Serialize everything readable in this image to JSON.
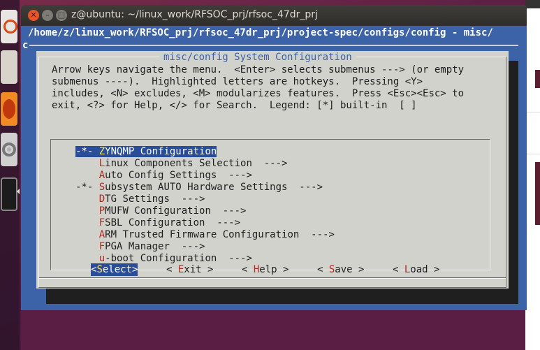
{
  "window": {
    "title": "z@ubuntu: ~/linux_work/RFSOC_prj/rfsoc_47dr_prj",
    "path_line": "/home/z/linux_work/RFSOC_prj/rfsoc_47dr_prj/project-spec/configs/config - misc/",
    "path_line_cont": "c",
    "close_label": "✕",
    "min_label": "–",
    "max_label": "□"
  },
  "dialog": {
    "title": "misc/config System Configuration",
    "help_text": "Arrow keys navigate the menu.  <Enter> selects submenus ---> (or empty\nsubmenus ----).  Highlighted letters are hotkeys.  Pressing <Y>\nincludes, <N> excludes, <M> modularizes features.  Press <Esc><Esc> to\nexit, <?> for Help, </> for Search.  Legend: [*] built-in  [ ]",
    "more_indicator": "↓(+)"
  },
  "menu": {
    "items": [
      {
        "prefix": "-*- ",
        "hotkey": "Z",
        "rest": "YNQMP Configuration",
        "suffix": "",
        "selected": true
      },
      {
        "prefix": "    ",
        "hotkey": "L",
        "rest": "inux Components Selection",
        "suffix": "  --->"
      },
      {
        "prefix": "    ",
        "hotkey": "A",
        "rest": "uto Config Settings",
        "suffix": "  --->"
      },
      {
        "prefix": "-*- ",
        "hotkey": "S",
        "rest": "ubsystem AUTO Hardware Settings",
        "suffix": "  --->"
      },
      {
        "prefix": "    ",
        "hotkey": "D",
        "rest": "TG Settings",
        "suffix": "  --->"
      },
      {
        "prefix": "    ",
        "hotkey": "P",
        "rest": "MUFW Configuration",
        "suffix": "  --->"
      },
      {
        "prefix": "    ",
        "hotkey": "F",
        "rest": "SBL Configuration",
        "suffix": "  --->"
      },
      {
        "prefix": "    ",
        "hotkey": "A",
        "rest": "RM Trusted Firmware Configuration",
        "suffix": "  --->"
      },
      {
        "prefix": "    ",
        "hotkey": "F",
        "rest": "PGA Manager",
        "suffix": "  --->"
      },
      {
        "prefix": "    ",
        "hotkey": "u",
        "rest": "-boot Configuration",
        "suffix": "  --->"
      }
    ]
  },
  "buttons": [
    {
      "pre": "<",
      "hotkey": "S",
      "rest": "elect>"
    },
    {
      "pre": "< ",
      "hotkey": "E",
      "rest": "xit >"
    },
    {
      "pre": "< ",
      "hotkey": "H",
      "rest": "elp >"
    },
    {
      "pre": "< ",
      "hotkey": "S",
      "rest": "ave >"
    },
    {
      "pre": "< ",
      "hotkey": "L",
      "rest": "oad >"
    }
  ],
  "colors": {
    "terminal_bg": "#3c62a8",
    "dialog_bg": "#d2d2cc",
    "title_color": "#3c62a8",
    "hotkey": "#b4261e",
    "selection_bg": "#2a4d9a",
    "more_indicator": "#4fbf3a"
  },
  "launcher": {
    "icons": [
      "ubuntu-software-icon",
      "files-icon",
      "firefox-icon",
      "system-settings-icon",
      "terminal-icon"
    ]
  }
}
